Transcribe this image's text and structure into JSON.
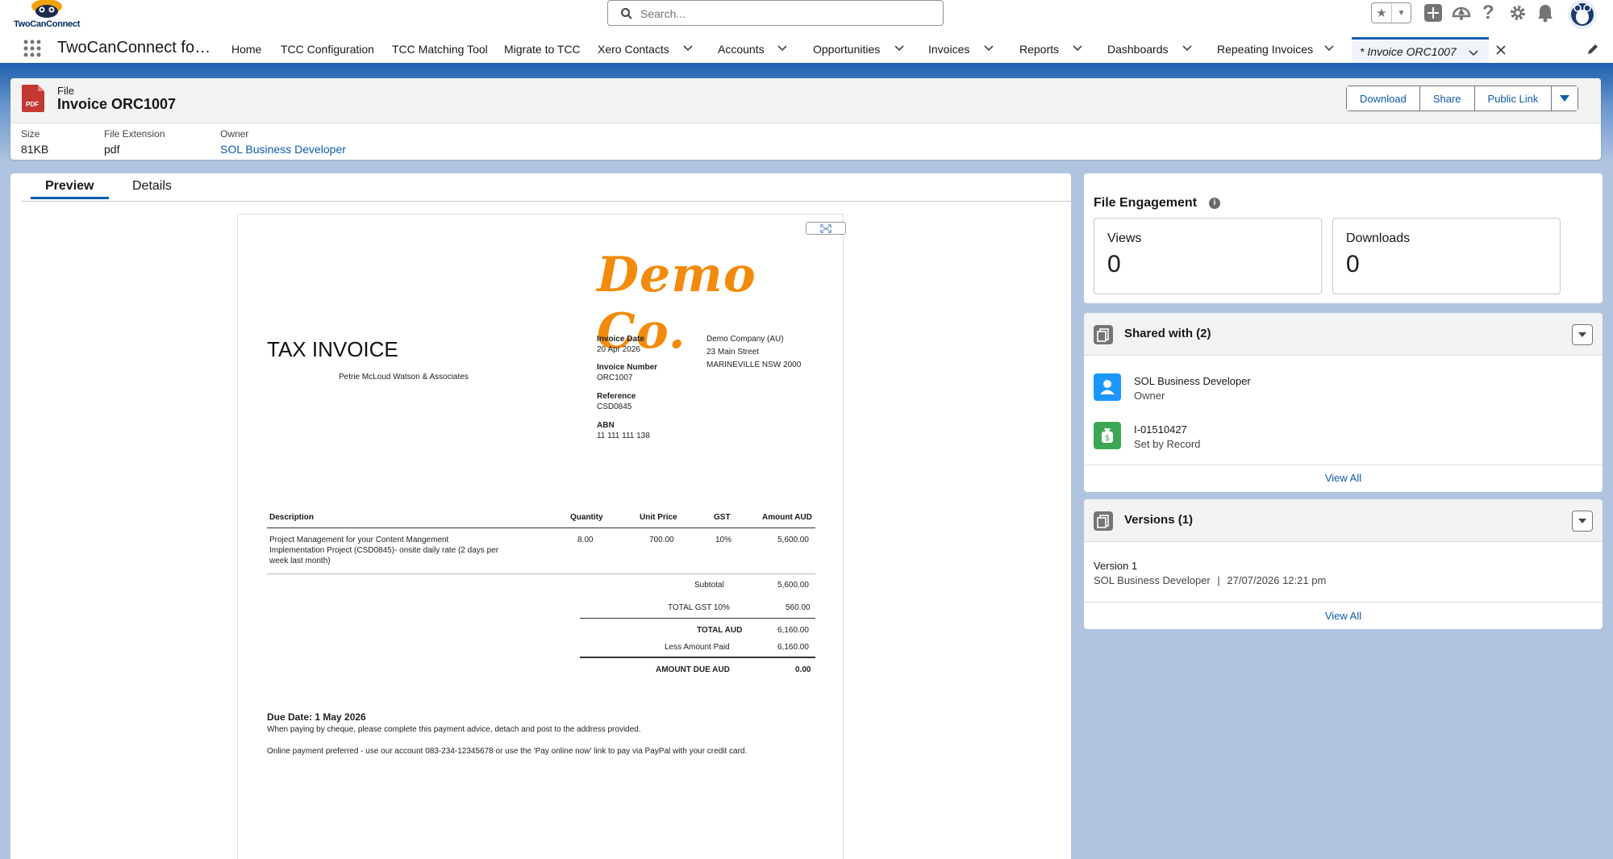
{
  "app": {
    "logo_text": "TwoCanConnect",
    "name": "TwoCanConnect fo…",
    "search_placeholder": "Search..."
  },
  "nav": {
    "items": [
      {
        "label": "Home",
        "dropdown": false
      },
      {
        "label": "TCC Configuration",
        "dropdown": false
      },
      {
        "label": "TCC Matching Tool",
        "dropdown": false
      },
      {
        "label": "Migrate to TCC",
        "dropdown": false
      },
      {
        "label": "Xero Contacts",
        "dropdown": true
      },
      {
        "label": "Accounts",
        "dropdown": true
      },
      {
        "label": "Opportunities",
        "dropdown": true
      },
      {
        "label": "Invoices",
        "dropdown": true
      },
      {
        "label": "Reports",
        "dropdown": true
      },
      {
        "label": "Dashboards",
        "dropdown": true
      },
      {
        "label": "Repeating Invoices",
        "dropdown": true
      }
    ],
    "active_tab": "* Invoice ORC1007"
  },
  "record": {
    "object_type": "File",
    "title": "Invoice ORC1007",
    "icon_text": "PDF",
    "actions": {
      "download": "Download",
      "share": "Share",
      "public_link": "Public Link"
    },
    "fields": {
      "size_label": "Size",
      "size_value": "81KB",
      "ext_label": "File Extension",
      "ext_value": "pdf",
      "owner_label": "Owner",
      "owner_value": "SOL Business Developer"
    }
  },
  "tabs": {
    "preview": "Preview",
    "details": "Details"
  },
  "invoice": {
    "brand": "Demo Co.",
    "heading": "TAX INVOICE",
    "bill_to": "Petrie McLoud Watson & Associates",
    "invoice_date_label": "Invoice Date",
    "invoice_date": "20 Apr 2026",
    "invoice_number_label": "Invoice Number",
    "invoice_number": "ORC1007",
    "reference_label": "Reference",
    "reference": "CSD0845",
    "abn_label": "ABN",
    "abn": "11 111 111 138",
    "from_line1": "Demo Company (AU)",
    "from_line2": "23 Main Street",
    "from_line3": "MARINEVILLE NSW 2000",
    "col_description": "Description",
    "col_quantity": "Quantity",
    "col_unit_price": "Unit Price",
    "col_gst": "GST",
    "col_amount": "Amount AUD",
    "line_desc1": "Project Management for your Content Mangement",
    "line_desc2": "Implementation Project (CSD0845)- onsite daily rate (2 days per",
    "line_desc3": "week last month)",
    "line_qty": "8.00",
    "line_price": "700.00",
    "line_gst": "10%",
    "line_amount": "5,600.00",
    "subtotal_label": "Subtotal",
    "subtotal": "5,600.00",
    "gst_total_label": "TOTAL  GST  10%",
    "gst_total": "560.00",
    "total_label": "TOTAL AUD",
    "total": "6,160.00",
    "paid_label": "Less Amount Paid",
    "paid": "6,160.00",
    "due_label": "AMOUNT DUE AUD",
    "due": "0.00",
    "due_date": "Due Date: 1 May 2026",
    "note1": "When paying by cheque, please complete this payment advice, detach and post to the address provided.",
    "note2": "Online payment preferred - use our account 083-234-12345678 or use the 'Pay online now' link to pay via PayPal with your credit card."
  },
  "engagement": {
    "title": "File Engagement",
    "views_label": "Views",
    "views": "0",
    "downloads_label": "Downloads",
    "downloads": "0"
  },
  "shared": {
    "title": "Shared with (2)",
    "items": [
      {
        "name": "SOL Business Developer",
        "role": "Owner"
      },
      {
        "name": "I-01510427",
        "role": "Set by Record"
      }
    ],
    "view_all": "View All"
  },
  "versions": {
    "title": "Versions (1)",
    "version_label": "Version 1",
    "version_by": "SOL Business Developer",
    "version_date": "27/07/2026 12:21 pm",
    "view_all": "View All"
  },
  "colors": {
    "brand_blue": "#1b5fb5",
    "link": "#0b5cab",
    "pdf_red": "#c23934",
    "demo_orange": "#f28b0c"
  }
}
